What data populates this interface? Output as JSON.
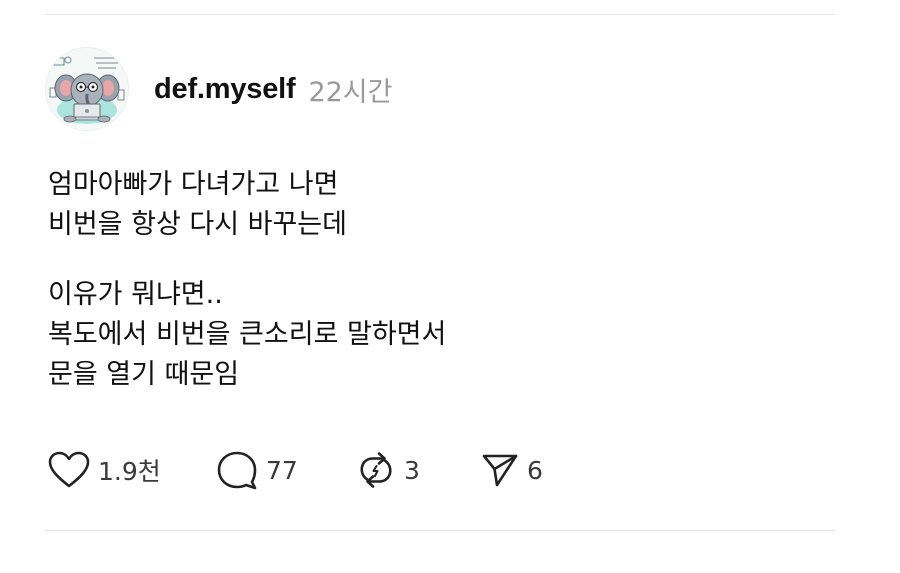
{
  "post": {
    "username": "def.myself",
    "time": "22시간",
    "paragraphs": [
      [
        "엄마아빠가 다녀가고 나면",
        "비번을 항상 다시 바꾸는데"
      ],
      [
        "이유가 뭐냐면..",
        "복도에서 비번을 큰소리로 말하면서",
        "문을 열기 때문임"
      ]
    ],
    "actions": {
      "like": {
        "icon": "heart-icon",
        "count": "1.9천"
      },
      "comment": {
        "icon": "comment-icon",
        "count": "77"
      },
      "repost": {
        "icon": "repost-icon",
        "count": "3"
      },
      "share": {
        "icon": "send-icon",
        "count": "6"
      }
    }
  },
  "colors": {
    "text": "#111111",
    "muted": "#9a9a9a",
    "divider": "#e3e3e3",
    "avatar_accent": "#4fb8b0"
  }
}
